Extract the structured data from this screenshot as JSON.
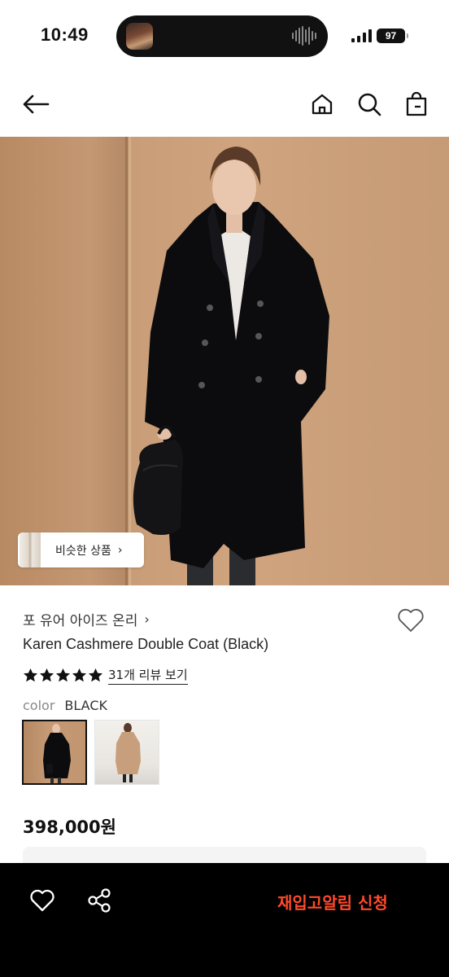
{
  "status_bar": {
    "time": "10:49",
    "battery": "97"
  },
  "nav": {
    "icons": [
      "back-arrow-icon",
      "home-icon",
      "search-icon",
      "shopping-bag-icon"
    ]
  },
  "hero": {
    "similar_button_label": "비슷한 상품",
    "similar_chevron": "›"
  },
  "product": {
    "brand": "포 유어 아이즈 온리",
    "brand_chevron": "›",
    "title": "Karen Cashmere Double Coat (Black)",
    "rating_stars": 5,
    "review_link": "31개 리뷰 보기",
    "color_label": "color",
    "color_value": "BLACK",
    "swatches": [
      "black",
      "camel"
    ],
    "price": "398,000원"
  },
  "bottom_bar": {
    "cta_label": "재입고알림 신청"
  },
  "colors": {
    "accent": "#ff4a2b",
    "bar_bg": "#000000",
    "text": "#111111"
  }
}
